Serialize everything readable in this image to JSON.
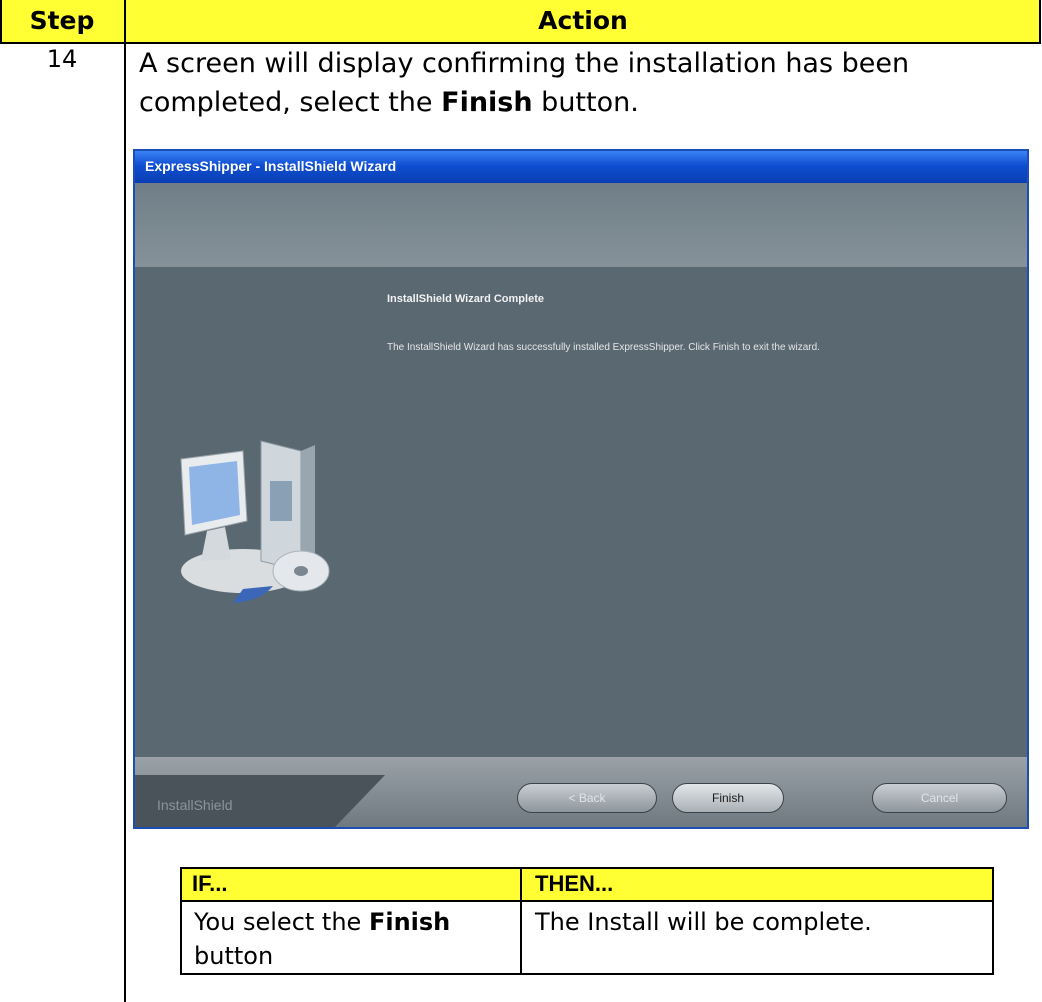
{
  "table": {
    "header": {
      "step": "Step",
      "action": "Action"
    },
    "row": {
      "step_number": "14",
      "instruction_prefix": "A screen will display confirming the installation has been completed, select the ",
      "instruction_bold": "Finish",
      "instruction_suffix": " button."
    }
  },
  "wizard": {
    "title": "ExpressShipper - InstallShield Wizard",
    "heading": "InstallShield Wizard Complete",
    "message": "The InstallShield Wizard has successfully installed ExpressShipper.  Click Finish to exit the wizard.",
    "brand": "InstallShield",
    "buttons": {
      "back": "< Back",
      "finish": "Finish",
      "cancel": "Cancel"
    },
    "colors": {
      "titlebar": "#0f4ed1",
      "body": "#5a6872",
      "banner": "#869299"
    }
  },
  "if_then": {
    "header": {
      "if": "IF...",
      "then": "THEN..."
    },
    "row": {
      "if_prefix": "You select the ",
      "if_bold": "Finish",
      "if_suffix": " button",
      "then": "The Install will be complete."
    }
  },
  "colors": {
    "header_yellow": "#ffff33"
  }
}
